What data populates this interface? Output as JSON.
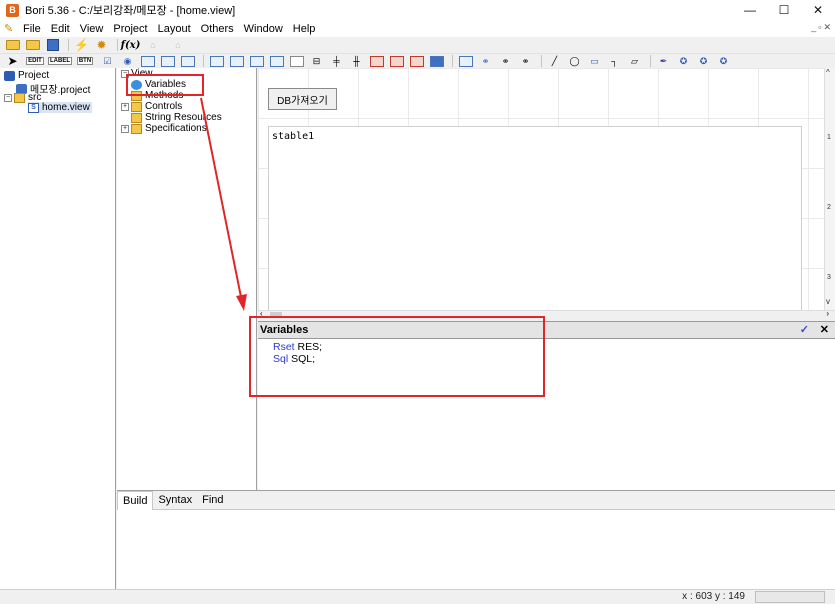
{
  "window": {
    "title": "Bori 5.36 - C:/보리강좌/메모장 - [home.view]",
    "minimize": "—",
    "maximize": "☐",
    "close": "✕"
  },
  "menu": [
    "File",
    "Edit",
    "View",
    "Project",
    "Layout",
    "Others",
    "Window",
    "Help"
  ],
  "toolbar": {
    "text_buttons": [
      "EDIT",
      "LABEL",
      "BTN"
    ]
  },
  "project_tree": {
    "root": "Project",
    "project_file": "메모장.project",
    "src_folder": "src",
    "view_file": "home.view"
  },
  "outline_tree": {
    "root": "View",
    "items": [
      "Variables",
      "Methods",
      "Controls",
      "String Resources",
      "Specifications"
    ]
  },
  "design": {
    "button_label": "DB가져오기",
    "table_label": "stable1",
    "ruler": [
      "1",
      "2",
      "3"
    ]
  },
  "variables_panel": {
    "title": "Variables",
    "lines": [
      {
        "type": "Rset",
        "name": "RES;"
      },
      {
        "type": "Sql",
        "name": "SQL;"
      }
    ]
  },
  "bottom_tabs": [
    "Build",
    "Syntax",
    "Find"
  ],
  "status": {
    "coords": "x : 603  y : 149"
  },
  "colors": {
    "annotation": "#e0262a",
    "keyword": "#2a39c9"
  }
}
